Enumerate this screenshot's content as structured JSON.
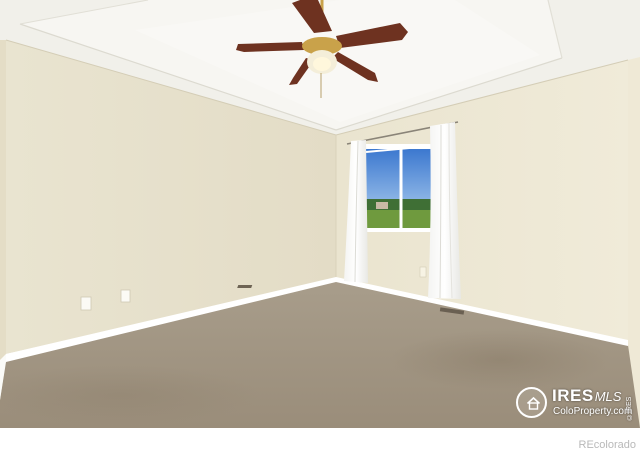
{
  "watermark": {
    "brand": "IRES",
    "brand_suffix": "MLS",
    "site": "ColoProperty.com",
    "vertical": "©IRES"
  },
  "footer": {
    "credit": "REcolorado"
  },
  "colors": {
    "walls": "#ece7d3",
    "ceiling": "#f4f3ee",
    "carpet": "#a19685",
    "trim": "#ffffff",
    "fan_blades": "#6e3220",
    "fan_brass": "#c9a24a",
    "sky": "#4f8ad6",
    "footer_text": "#b9b9b9"
  },
  "icons": [
    "house-icon"
  ]
}
